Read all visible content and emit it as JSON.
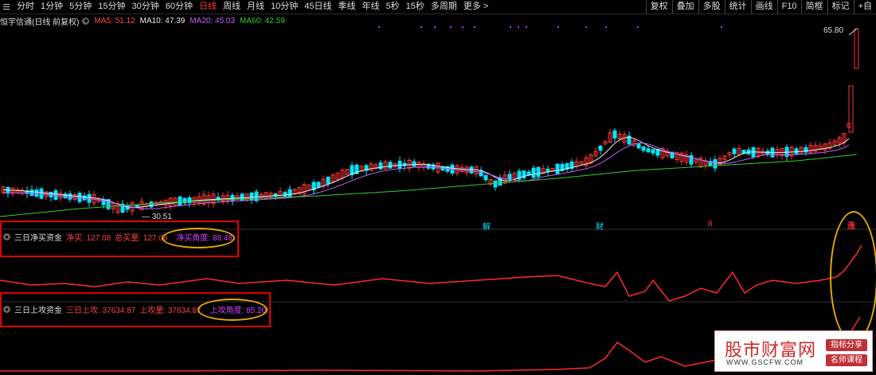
{
  "toolbar": {
    "timeframes": [
      "分时",
      "1分钟",
      "5分钟",
      "15分钟",
      "30分钟",
      "60分钟",
      "日线",
      "周线",
      "月线",
      "10分钟",
      "45日线",
      "季线",
      "年线",
      "5秒",
      "15秒",
      "多周期",
      "更多 >"
    ],
    "active": "日线",
    "tools": [
      "复权",
      "叠加",
      "多股",
      "统计",
      "画线",
      "F10",
      "简框",
      "标记",
      "+自"
    ]
  },
  "main_chart": {
    "title": "恒宇信通(日线 前复权)",
    "ma": [
      {
        "label": "MA5: 51.12",
        "color": "#ff4a4a"
      },
      {
        "label": "MA10: 47.39",
        "color": "#e8e8e8"
      },
      {
        "label": "MA20: 45.03",
        "color": "#c060ff"
      },
      {
        "label": "MA60: 42.59",
        "color": "#33cc33"
      }
    ],
    "high_label": "65.80",
    "low_label": "30.51",
    "markers": [
      "解",
      "财",
      "8",
      "涨"
    ]
  },
  "indicator1": {
    "title": "三日净买资金",
    "fields": [
      {
        "label": "净买: 127.08",
        "color": "#ff4040"
      },
      {
        "label": "总买量: 127.08",
        "color": "#ff4040"
      },
      {
        "label": "净买角度: 88.48",
        "color": "#d040ff"
      }
    ]
  },
  "indicator2": {
    "title": "三日上攻资金",
    "fields": [
      {
        "label": "三日上攻: 37634.87",
        "color": "#ff4040"
      },
      {
        "label": "上攻量: 37634.87",
        "color": "#ff4040"
      },
      {
        "label": "上攻角度: 85.20",
        "color": "#d040ff"
      }
    ]
  },
  "watermark": {
    "site": "股市财富网",
    "url": "WWW.GSCFW.COM",
    "tag1": "指标分享",
    "tag2": "名师课程"
  },
  "colors": {
    "up": "#ff3333",
    "down": "#00e5ff",
    "ma5": "#ff4a4a",
    "ma10": "#e8e8e8",
    "ma20": "#c060ff",
    "ma60": "#33cc33",
    "annotation_box": "#e00000",
    "annotation_ellipse": "#e8a800"
  },
  "chart_data": {
    "type": "line",
    "series": [
      {
        "name": "MA5",
        "values": [
          null
        ]
      },
      {
        "name": "MA60",
        "values": [
          null
        ]
      }
    ]
  }
}
